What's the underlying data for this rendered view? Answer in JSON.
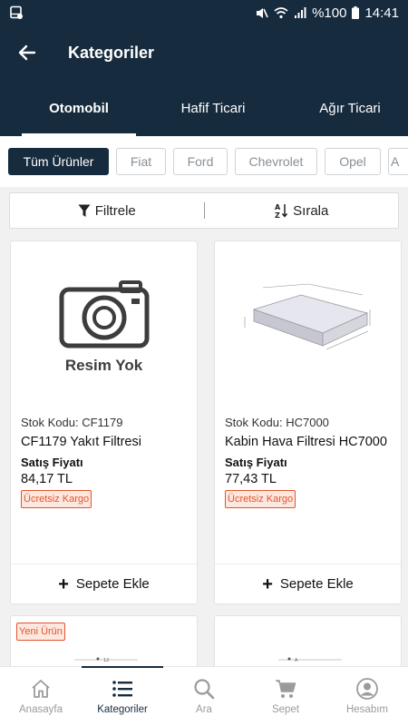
{
  "status": {
    "battery": "%100",
    "time": "14:41"
  },
  "header": {
    "title": "Kategoriler"
  },
  "tabs": [
    {
      "label": "Otomobil",
      "active": true
    },
    {
      "label": "Hafif Ticari",
      "active": false
    },
    {
      "label": "Ağır Ticari",
      "active": false
    }
  ],
  "brands": [
    {
      "label": "Tüm Ürünler",
      "active": true
    },
    {
      "label": "Fiat"
    },
    {
      "label": "Ford"
    },
    {
      "label": "Chevrolet"
    },
    {
      "label": "Opel"
    },
    {
      "label": "A"
    }
  ],
  "toolbar": {
    "filter_label": "Filtrele",
    "sort_label": "Sırala"
  },
  "products": [
    {
      "no_image_text": "Resim Yok",
      "code": "Stok Kodu: CF1179",
      "name": "CF1179 Yakıt Filtresi",
      "price_label": "Satış Fiyatı",
      "price": "84,17 TL",
      "badge": "Ücretsiz Kargo",
      "add_label": "Sepete Ekle"
    },
    {
      "code": "Stok Kodu: HC7000",
      "name": "Kabin Hava Filtresi HC7000",
      "price_label": "Satış Fiyatı",
      "price": "77,43 TL",
      "badge": "Ücretsiz Kargo",
      "add_label": "Sepete Ekle"
    },
    {
      "new_badge": "Yeni Ürün"
    },
    {}
  ],
  "bottom_nav": [
    {
      "label": "Anasayfa",
      "icon": "home-icon"
    },
    {
      "label": "Kategoriler",
      "icon": "list-icon",
      "active": true
    },
    {
      "label": "Ara",
      "icon": "search-icon"
    },
    {
      "label": "Sepet",
      "icon": "cart-icon"
    },
    {
      "label": "Hesabım",
      "icon": "account-icon"
    }
  ],
  "colors": {
    "primary": "#172b3e",
    "accent": "#e2552d",
    "badge_bg": "#fde7df"
  }
}
